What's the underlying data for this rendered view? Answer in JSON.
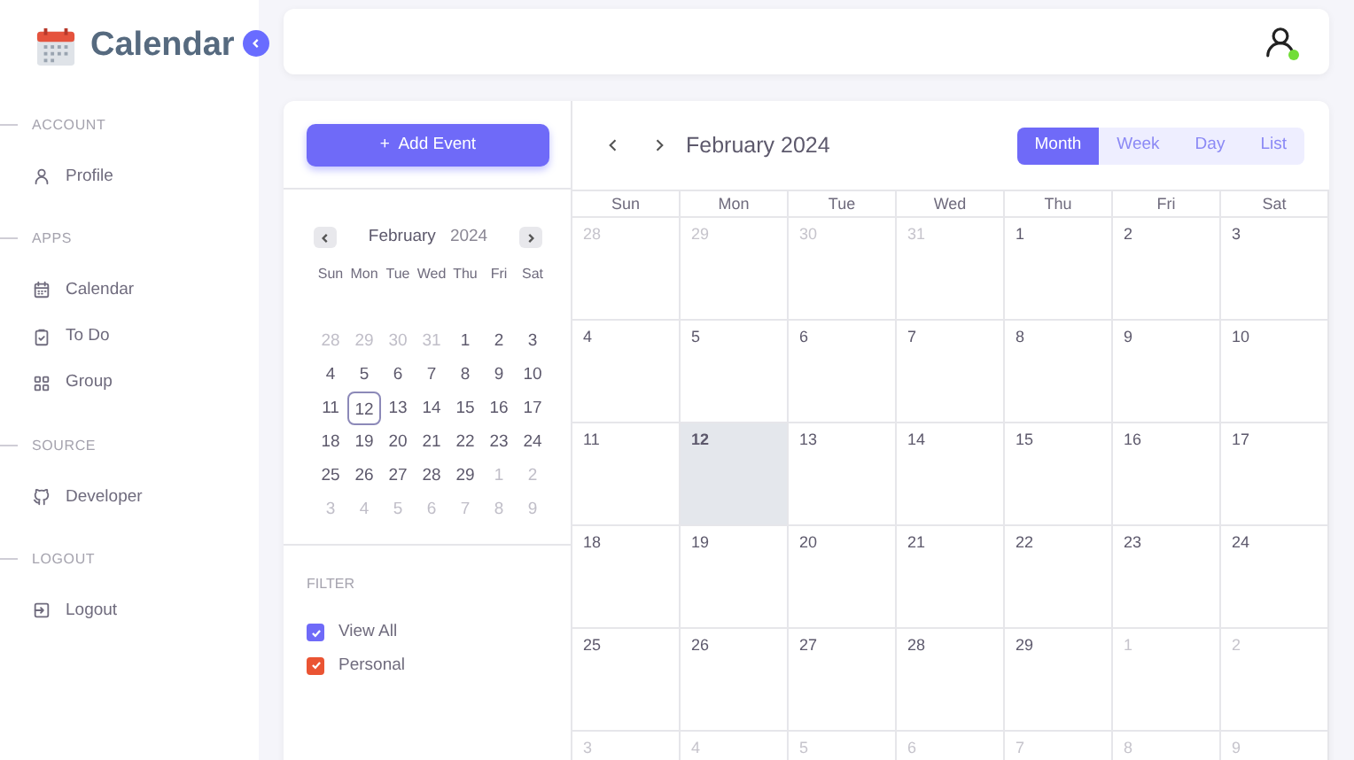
{
  "brand": {
    "title": "Calendar"
  },
  "sidebar": {
    "sections": [
      {
        "heading": "ACCOUNT",
        "items": [
          {
            "label": "Profile"
          }
        ]
      },
      {
        "heading": "APPS",
        "items": [
          {
            "label": "Calendar"
          },
          {
            "label": "To Do"
          },
          {
            "label": "Group"
          }
        ]
      },
      {
        "heading": "SOURCE",
        "items": [
          {
            "label": "Developer"
          }
        ]
      },
      {
        "heading": "LOGOUT",
        "items": [
          {
            "label": "Logout"
          }
        ]
      }
    ]
  },
  "topbar": {
    "user_online": true
  },
  "add_event_button": {
    "label": "Add Event",
    "icon": "+"
  },
  "mini_calendar": {
    "month": "February",
    "year": "2024",
    "weekdays": [
      "Sun",
      "Mon",
      "Tue",
      "Wed",
      "Thu",
      "Fri",
      "Sat"
    ],
    "weeks": [
      [
        {
          "day": "28",
          "outside": true,
          "selected": false
        },
        {
          "day": "29",
          "outside": true,
          "selected": false
        },
        {
          "day": "30",
          "outside": true,
          "selected": false
        },
        {
          "day": "31",
          "outside": true,
          "selected": false
        },
        {
          "day": "1",
          "outside": false,
          "selected": false
        },
        {
          "day": "2",
          "outside": false,
          "selected": false
        },
        {
          "day": "3",
          "outside": false,
          "selected": false
        }
      ],
      [
        {
          "day": "4",
          "outside": false,
          "selected": false
        },
        {
          "day": "5",
          "outside": false,
          "selected": false
        },
        {
          "day": "6",
          "outside": false,
          "selected": false
        },
        {
          "day": "7",
          "outside": false,
          "selected": false
        },
        {
          "day": "8",
          "outside": false,
          "selected": false
        },
        {
          "day": "9",
          "outside": false,
          "selected": false
        },
        {
          "day": "10",
          "outside": false,
          "selected": false
        }
      ],
      [
        {
          "day": "11",
          "outside": false,
          "selected": false
        },
        {
          "day": "12",
          "outside": false,
          "selected": true
        },
        {
          "day": "13",
          "outside": false,
          "selected": false
        },
        {
          "day": "14",
          "outside": false,
          "selected": false
        },
        {
          "day": "15",
          "outside": false,
          "selected": false
        },
        {
          "day": "16",
          "outside": false,
          "selected": false
        },
        {
          "day": "17",
          "outside": false,
          "selected": false
        }
      ],
      [
        {
          "day": "18",
          "outside": false,
          "selected": false
        },
        {
          "day": "19",
          "outside": false,
          "selected": false
        },
        {
          "day": "20",
          "outside": false,
          "selected": false
        },
        {
          "day": "21",
          "outside": false,
          "selected": false
        },
        {
          "day": "22",
          "outside": false,
          "selected": false
        },
        {
          "day": "23",
          "outside": false,
          "selected": false
        },
        {
          "day": "24",
          "outside": false,
          "selected": false
        }
      ],
      [
        {
          "day": "25",
          "outside": false,
          "selected": false
        },
        {
          "day": "26",
          "outside": false,
          "selected": false
        },
        {
          "day": "27",
          "outside": false,
          "selected": false
        },
        {
          "day": "28",
          "outside": false,
          "selected": false
        },
        {
          "day": "29",
          "outside": false,
          "selected": false
        },
        {
          "day": "1",
          "outside": true,
          "selected": false
        },
        {
          "day": "2",
          "outside": true,
          "selected": false
        }
      ],
      [
        {
          "day": "3",
          "outside": true,
          "selected": false
        },
        {
          "day": "4",
          "outside": true,
          "selected": false
        },
        {
          "day": "5",
          "outside": true,
          "selected": false
        },
        {
          "day": "6",
          "outside": true,
          "selected": false
        },
        {
          "day": "7",
          "outside": true,
          "selected": false
        },
        {
          "day": "8",
          "outside": true,
          "selected": false
        },
        {
          "day": "9",
          "outside": true,
          "selected": false
        }
      ]
    ]
  },
  "filter": {
    "heading": "FILTER",
    "options": [
      {
        "label": "View All",
        "checked": true,
        "color": "#6f6af8"
      },
      {
        "label": "Personal",
        "checked": true,
        "color": "#ea5433"
      }
    ]
  },
  "calendar": {
    "title": "February 2024",
    "views": [
      {
        "label": "Month",
        "selected": true
      },
      {
        "label": "Week",
        "selected": false
      },
      {
        "label": "Day",
        "selected": false
      },
      {
        "label": "List",
        "selected": false
      }
    ],
    "weekdays": [
      "Sun",
      "Mon",
      "Tue",
      "Wed",
      "Thu",
      "Fri",
      "Sat"
    ],
    "weeks": [
      [
        {
          "day": "28",
          "outside": true,
          "today": false
        },
        {
          "day": "29",
          "outside": true,
          "today": false
        },
        {
          "day": "30",
          "outside": true,
          "today": false
        },
        {
          "day": "31",
          "outside": true,
          "today": false
        },
        {
          "day": "1",
          "outside": false,
          "today": false
        },
        {
          "day": "2",
          "outside": false,
          "today": false
        },
        {
          "day": "3",
          "outside": false,
          "today": false
        }
      ],
      [
        {
          "day": "4",
          "outside": false,
          "today": false
        },
        {
          "day": "5",
          "outside": false,
          "today": false
        },
        {
          "day": "6",
          "outside": false,
          "today": false
        },
        {
          "day": "7",
          "outside": false,
          "today": false
        },
        {
          "day": "8",
          "outside": false,
          "today": false
        },
        {
          "day": "9",
          "outside": false,
          "today": false
        },
        {
          "day": "10",
          "outside": false,
          "today": false
        }
      ],
      [
        {
          "day": "11",
          "outside": false,
          "today": false
        },
        {
          "day": "12",
          "outside": false,
          "today": true
        },
        {
          "day": "13",
          "outside": false,
          "today": false
        },
        {
          "day": "14",
          "outside": false,
          "today": false
        },
        {
          "day": "15",
          "outside": false,
          "today": false
        },
        {
          "day": "16",
          "outside": false,
          "today": false
        },
        {
          "day": "17",
          "outside": false,
          "today": false
        }
      ],
      [
        {
          "day": "18",
          "outside": false,
          "today": false
        },
        {
          "day": "19",
          "outside": false,
          "today": false
        },
        {
          "day": "20",
          "outside": false,
          "today": false
        },
        {
          "day": "21",
          "outside": false,
          "today": false
        },
        {
          "day": "22",
          "outside": false,
          "today": false
        },
        {
          "day": "23",
          "outside": false,
          "today": false
        },
        {
          "day": "24",
          "outside": false,
          "today": false
        }
      ],
      [
        {
          "day": "25",
          "outside": false,
          "today": false
        },
        {
          "day": "26",
          "outside": false,
          "today": false
        },
        {
          "day": "27",
          "outside": false,
          "today": false
        },
        {
          "day": "28",
          "outside": false,
          "today": false
        },
        {
          "day": "29",
          "outside": false,
          "today": false
        },
        {
          "day": "1",
          "outside": true,
          "today": false
        },
        {
          "day": "2",
          "outside": true,
          "today": false
        }
      ],
      [
        {
          "day": "3",
          "outside": true,
          "today": false
        },
        {
          "day": "4",
          "outside": true,
          "today": false
        },
        {
          "day": "5",
          "outside": true,
          "today": false
        },
        {
          "day": "6",
          "outside": true,
          "today": false
        },
        {
          "day": "7",
          "outside": true,
          "today": false
        },
        {
          "day": "8",
          "outside": true,
          "today": false
        },
        {
          "day": "9",
          "outside": true,
          "today": false
        }
      ]
    ]
  }
}
